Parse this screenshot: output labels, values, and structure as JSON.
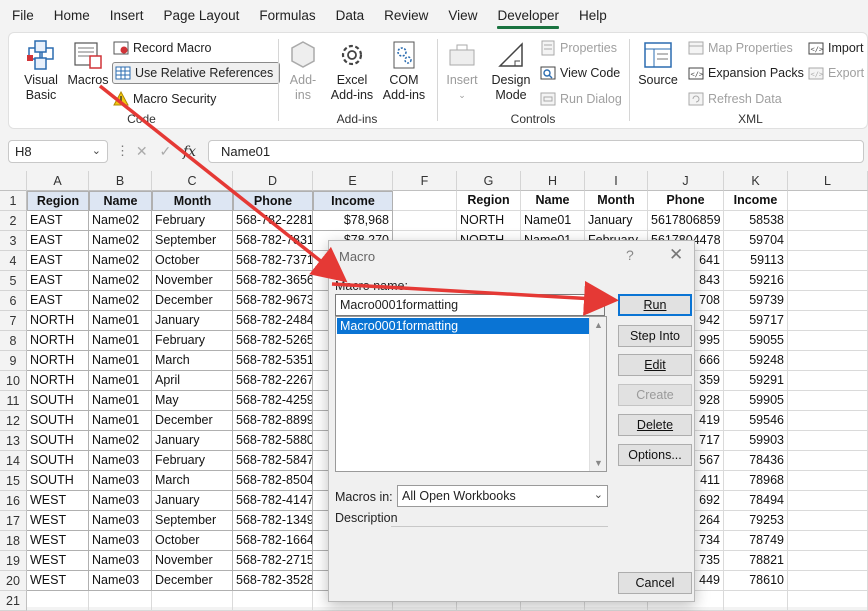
{
  "menu": [
    "File",
    "Home",
    "Insert",
    "Page Layout",
    "Formulas",
    "Data",
    "Review",
    "View",
    "Developer",
    "Help"
  ],
  "ribbon": {
    "code": {
      "label": "Code",
      "visual_basic": "Visual Basic",
      "macros": "Macros",
      "record_macro": "Record Macro",
      "use_relative": "Use Relative References",
      "macro_security": "Macro Security"
    },
    "addins": {
      "label": "Add-ins",
      "addins": "Add-ins",
      "excel_addins": "Excel Add-ins",
      "com_addins": "COM Add-ins"
    },
    "controls": {
      "label": "Controls",
      "insert": "Insert",
      "design_mode": "Design Mode",
      "properties": "Properties",
      "view_code": "View Code",
      "run_dialog": "Run Dialog"
    },
    "xml": {
      "label": "XML",
      "source": "Source",
      "map_properties": "Map Properties",
      "expansion_packs": "Expansion Packs",
      "refresh_data": "Refresh Data",
      "import": "Import",
      "export": "Export"
    }
  },
  "formula_bar": {
    "name_box": "H8",
    "formula": "Name01",
    "fx": "fx"
  },
  "columns": [
    "A",
    "B",
    "C",
    "D",
    "E",
    "F",
    "G",
    "H",
    "I",
    "J",
    "K",
    "L"
  ],
  "rows": [
    "1",
    "2",
    "3",
    "4",
    "5",
    "6",
    "7",
    "8",
    "9",
    "10",
    "11",
    "12",
    "13",
    "14",
    "15",
    "16",
    "17",
    "18",
    "19",
    "20",
    "21"
  ],
  "left_table": {
    "headers": [
      "Region",
      "Name",
      "Month",
      "Phone",
      "Income"
    ],
    "rows": [
      [
        "EAST",
        "Name02",
        "February",
        "568-782-2281",
        "$78,968"
      ],
      [
        "EAST",
        "Name02",
        "September",
        "568-782-7831",
        "$78,270"
      ],
      [
        "EAST",
        "Name02",
        "October",
        "568-782-7371",
        ""
      ],
      [
        "EAST",
        "Name02",
        "November",
        "568-782-3656",
        ""
      ],
      [
        "EAST",
        "Name02",
        "December",
        "568-782-9673",
        ""
      ],
      [
        "NORTH",
        "Name01",
        "January",
        "568-782-2484",
        ""
      ],
      [
        "NORTH",
        "Name01",
        "February",
        "568-782-5265",
        ""
      ],
      [
        "NORTH",
        "Name01",
        "March",
        "568-782-5351",
        ""
      ],
      [
        "NORTH",
        "Name01",
        "April",
        "568-782-2267",
        ""
      ],
      [
        "SOUTH",
        "Name01",
        "May",
        "568-782-4259",
        ""
      ],
      [
        "SOUTH",
        "Name01",
        "December",
        "568-782-8899",
        ""
      ],
      [
        "SOUTH",
        "Name02",
        "January",
        "568-782-5880",
        ""
      ],
      [
        "SOUTH",
        "Name03",
        "February",
        "568-782-5847",
        ""
      ],
      [
        "SOUTH",
        "Name03",
        "March",
        "568-782-8504",
        ""
      ],
      [
        "WEST",
        "Name03",
        "January",
        "568-782-4147",
        ""
      ],
      [
        "WEST",
        "Name03",
        "September",
        "568-782-1349",
        ""
      ],
      [
        "WEST",
        "Name03",
        "October",
        "568-782-1664",
        ""
      ],
      [
        "WEST",
        "Name03",
        "November",
        "568-782-2715",
        ""
      ],
      [
        "WEST",
        "Name03",
        "December",
        "568-782-3528",
        ""
      ]
    ]
  },
  "right_table": {
    "headers": [
      "Region",
      "Name",
      "Month",
      "Phone",
      "Income"
    ],
    "rows": [
      [
        "NORTH",
        "Name01",
        "January",
        "5617806859",
        "58538"
      ],
      [
        "NORTH",
        "Name01",
        "February",
        "5617804478",
        "59704"
      ],
      [
        "",
        "",
        "",
        "641",
        "59113"
      ],
      [
        "",
        "",
        "",
        "843",
        "59216"
      ],
      [
        "",
        "",
        "",
        "708",
        "59739"
      ],
      [
        "",
        "",
        "",
        "942",
        "59717"
      ],
      [
        "",
        "",
        "",
        "995",
        "59055"
      ],
      [
        "",
        "",
        "",
        "666",
        "59248"
      ],
      [
        "",
        "",
        "",
        "359",
        "59291"
      ],
      [
        "",
        "",
        "",
        "928",
        "59905"
      ],
      [
        "",
        "",
        "",
        "419",
        "59546"
      ],
      [
        "",
        "",
        "",
        "717",
        "59903"
      ],
      [
        "",
        "",
        "",
        "567",
        "78436"
      ],
      [
        "",
        "",
        "",
        "411",
        "78968"
      ],
      [
        "",
        "",
        "",
        "692",
        "78494"
      ],
      [
        "",
        "",
        "",
        "264",
        "79253"
      ],
      [
        "",
        "",
        "",
        "734",
        "78749"
      ],
      [
        "",
        "",
        "",
        "735",
        "78821"
      ],
      [
        "",
        "",
        "",
        "449",
        "78610"
      ]
    ]
  },
  "dialog": {
    "title": "Macro",
    "help": "?",
    "close": "✕",
    "macro_name_label": "Macro name:",
    "macro_name_value": "Macro0001formatting",
    "list_items": [
      "Macro0001formatting"
    ],
    "macros_in_label": "Macros in:",
    "macros_in_value": "All Open Workbooks",
    "description_label": "Description",
    "buttons": {
      "run": "Run",
      "step_into": "Step Into",
      "edit": "Edit",
      "create": "Create",
      "delete": "Delete",
      "options": "Options...",
      "cancel": "Cancel"
    }
  },
  "colors": {
    "accent_green": "#1a7340",
    "selection_blue": "#0a74d4",
    "header_fill": "#dde6f3",
    "arrow_red": "#e53935"
  }
}
